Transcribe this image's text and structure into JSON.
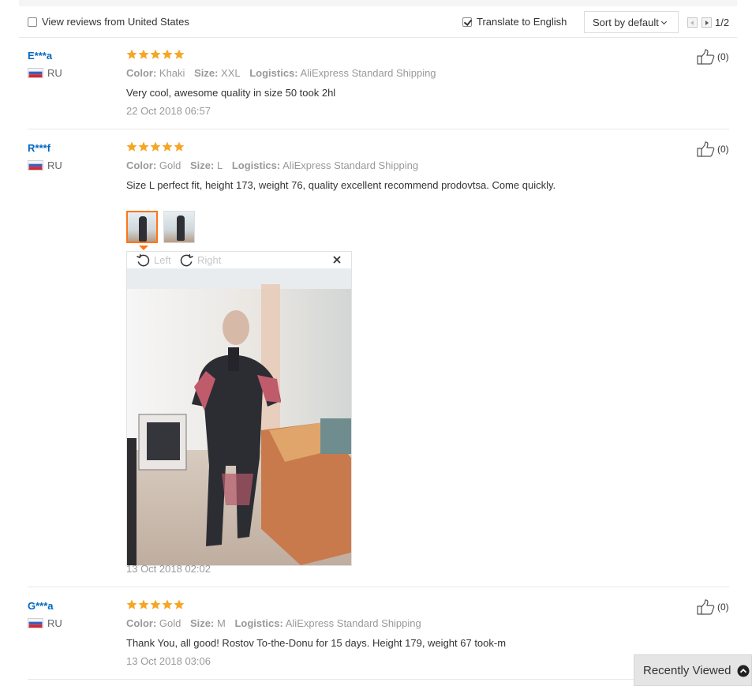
{
  "filters": {
    "local_reviews_label": "View reviews from United States",
    "local_reviews_checked": false,
    "translate_label": "Translate to English",
    "translate_checked": true,
    "sort_label": "Sort by default",
    "pagination": "1/2"
  },
  "reviews": [
    {
      "user": "E***a",
      "country": "RU",
      "rating": 5,
      "color_label": "Color:",
      "color": "Khaki",
      "size_label": "Size:",
      "size": "XXL",
      "logistics_label": "Logistics:",
      "logistics": "AliExpress Standard Shipping",
      "text": "Very cool, awesome quality in size 50 took 2hl",
      "date": "22 Oct 2018 06:57",
      "likes": "(0)"
    },
    {
      "user": "R***f",
      "country": "RU",
      "rating": 5,
      "color_label": "Color:",
      "color": "Gold",
      "size_label": "Size:",
      "size": "L",
      "logistics_label": "Logistics:",
      "logistics": "AliExpress Standard Shipping",
      "text": "Size L perfect fit, height 173, weight 76, quality excellent recommend prodovtsa. Come quickly.",
      "date": "13 Oct 2018 02:02",
      "likes": "(0)",
      "photo_count": 2,
      "viewer": {
        "rotate_left": "Left",
        "rotate_right": "Right"
      }
    },
    {
      "user": "G***a",
      "country": "RU",
      "rating": 5,
      "color_label": "Color:",
      "color": "Gold",
      "size_label": "Size:",
      "size": "M",
      "logistics_label": "Logistics:",
      "logistics": "AliExpress Standard Shipping",
      "text": "Thank You, all good! Rostov To-the-Donu for 15 days. Height 179, weight 67 took-m",
      "date": "13 Oct 2018 03:06",
      "likes": "(0)"
    }
  ],
  "recently_viewed": {
    "label": "Recently Viewed"
  },
  "colors": {
    "star": "#f5a623",
    "username": "#0066c0",
    "accent": "#ff7518"
  }
}
